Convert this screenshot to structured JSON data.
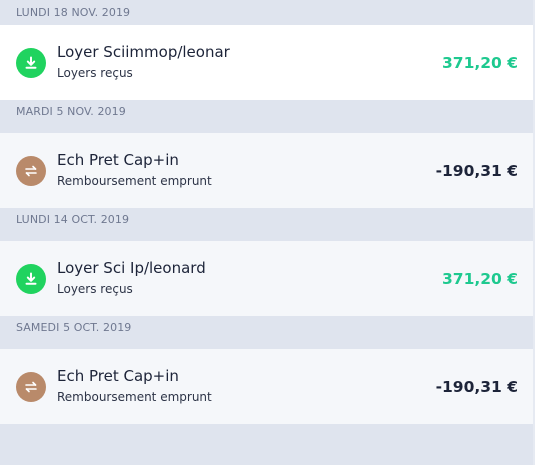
{
  "colors": {
    "income_icon": "#20d35f",
    "transfer_icon": "#b98a6a",
    "positive_amount": "#1ec98f",
    "negative_amount": "#1d2439",
    "header_bg": "#dfe4ee"
  },
  "groups": [
    {
      "date": "LUNDI 18 NOV. 2019",
      "transaction": {
        "icon": "download-icon",
        "title": "Loyer Sciimmop/leonar",
        "category": "Loyers reçus",
        "amount": "371,20 €"
      }
    },
    {
      "date": "MARDI 5 NOV. 2019",
      "transaction": {
        "icon": "transfer-arrows-icon",
        "title": "Ech Pret Cap+in",
        "category": "Remboursement emprunt",
        "amount": "-190,31 €"
      }
    },
    {
      "date": "LUNDI 14 OCT. 2019",
      "transaction": {
        "icon": "download-icon",
        "title": "Loyer Sci Ip/leonard",
        "category": "Loyers reçus",
        "amount": "371,20 €"
      }
    },
    {
      "date": "SAMEDI 5 OCT. 2019",
      "transaction": {
        "icon": "transfer-arrows-icon",
        "title": "Ech Pret Cap+in",
        "category": "Remboursement emprunt",
        "amount": "-190,31 €"
      }
    }
  ]
}
